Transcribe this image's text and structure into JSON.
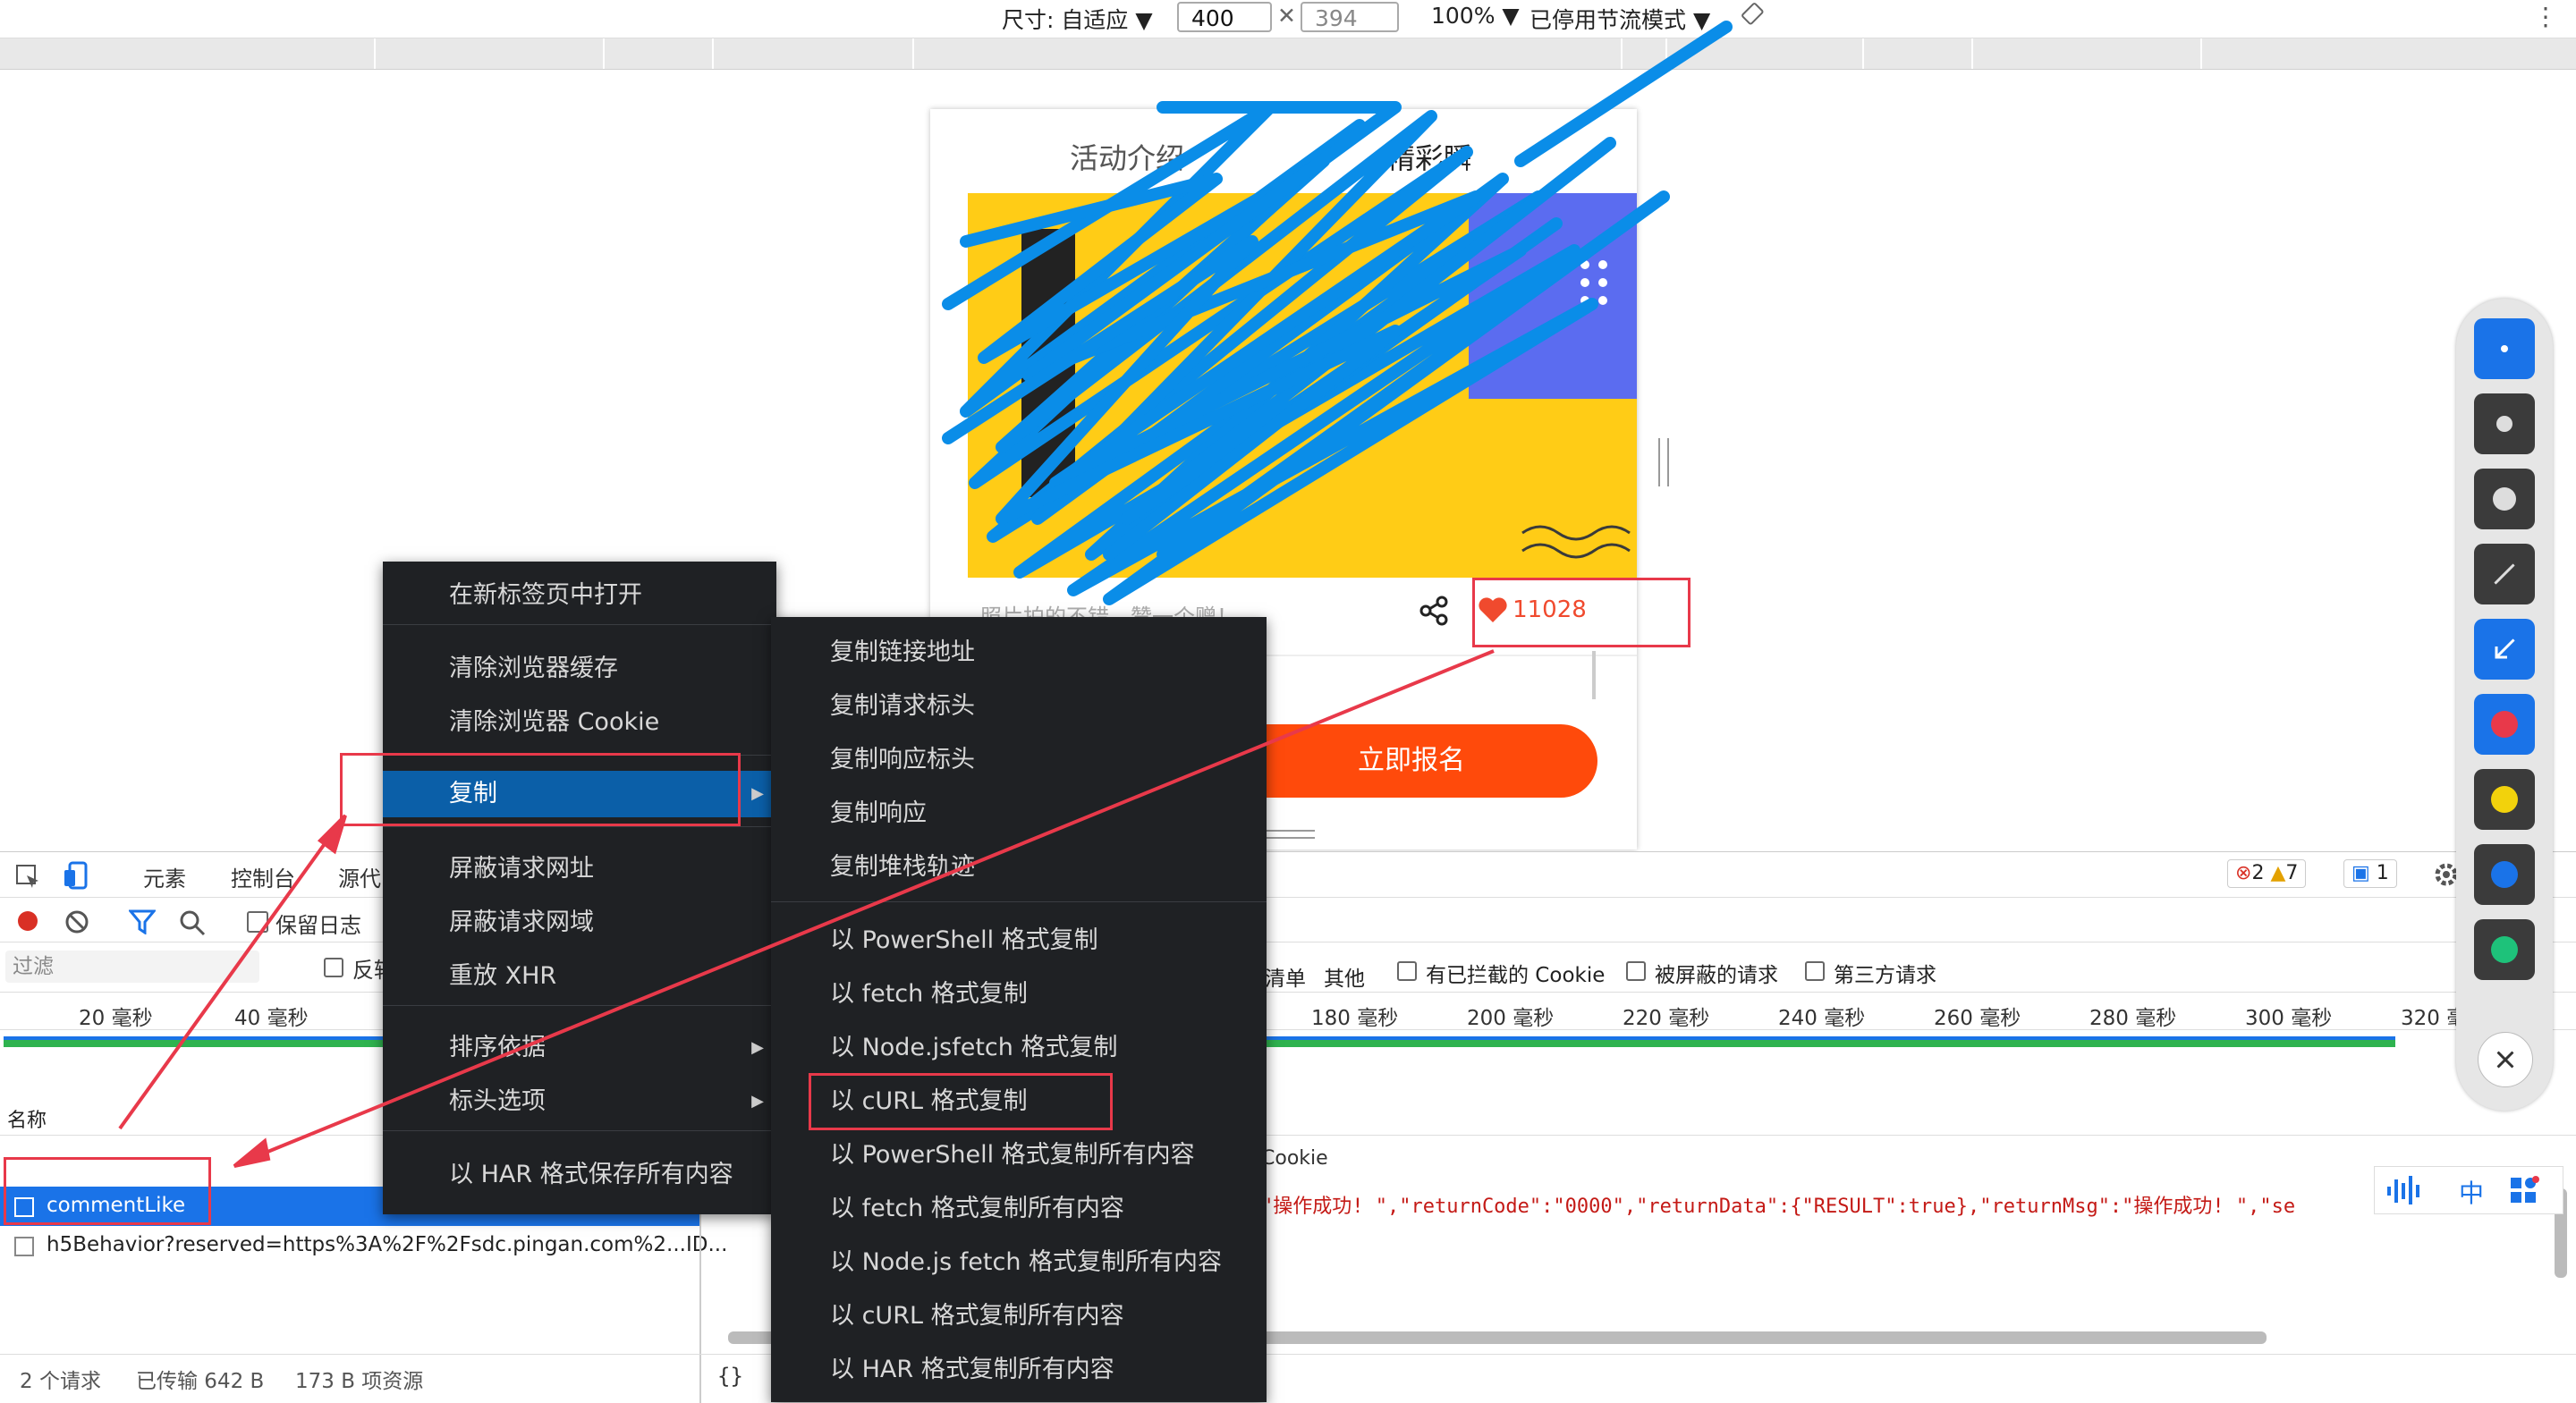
{
  "device_toolbar": {
    "size_label": "尺寸: 自适应 ▼",
    "width_value": "400",
    "times": "✕",
    "height_value": "394",
    "zoom": "100% ▼",
    "throttle": "已停用节流模式 ▼",
    "more": "⋮"
  },
  "page": {
    "tab_active": "活动介绍",
    "tab_other": "精彩瞬",
    "caption": "照片拍的不错，赞一个赠！",
    "like_count": "11028",
    "signup_button": "立即报名"
  },
  "devtools": {
    "tabs": [
      "元素",
      "控制台",
      "源代"
    ],
    "preserve_log": "保留日志",
    "filter_placeholder": "过滤",
    "invert": "反转",
    "type_filters": [
      "清单",
      "其他"
    ],
    "blocked_cookie": "有已拦截的 Cookie",
    "blocked_requests": "被屏蔽的请求",
    "third_party": "第三方请求",
    "badges": {
      "errors": "2",
      "warnings": "7",
      "messages": "1"
    },
    "timeline_left": [
      "20 毫秒",
      "40 毫秒"
    ],
    "timeline_right": [
      "180 毫秒",
      "200 毫秒",
      "220 毫秒",
      "240 毫秒",
      "260 毫秒",
      "280 毫秒",
      "300 毫秒",
      "320 毫秒"
    ],
    "name_header": "名称",
    "requests": [
      "commentLike",
      "h5Behavior?reserved=https%3A%2F%2Fsdc.pingan.com%2...ID..."
    ],
    "cookie_tab": "Cookie",
    "response_text": "\"操作成功! \",\"returnCode\":\"0000\",\"returnData\":{\"RESULT\":true},\"returnMsg\":\"操作成功! \",\"se",
    "status_requests": "2 个请求",
    "status_transferred": "已传输 642 B",
    "status_resources": "173 B 项资源",
    "pretty_print": "{}"
  },
  "menu_main": {
    "items": [
      "在新标签页中打开",
      "清除浏览器缓存",
      "清除浏览器 Cookie",
      "复制",
      "屏蔽请求网址",
      "屏蔽请求网域",
      "重放 XHR",
      "排序依据",
      "标头选项",
      "以 HAR 格式保存所有内容"
    ]
  },
  "menu_copy": {
    "items": [
      "复制链接地址",
      "复制请求标头",
      "复制响应标头",
      "复制响应",
      "复制堆栈轨迹",
      "以 PowerShell 格式复制",
      "以 fetch 格式复制",
      "以 Node.jsfetch 格式复制",
      "以 cURL 格式复制",
      "以 PowerShell 格式复制所有内容",
      "以 fetch 格式复制所有内容",
      "以 Node.js fetch 格式复制所有内容",
      "以 cURL 格式复制所有内容",
      "以 HAR 格式复制所有内容"
    ]
  },
  "ime": {
    "lang": "中"
  },
  "colors": {
    "accent_blue": "#1a73e8",
    "annotation_red": "#e8394a",
    "menu_bg": "#1f2124",
    "scribble": "#0a8de8",
    "signup": "#ff4a0b"
  }
}
